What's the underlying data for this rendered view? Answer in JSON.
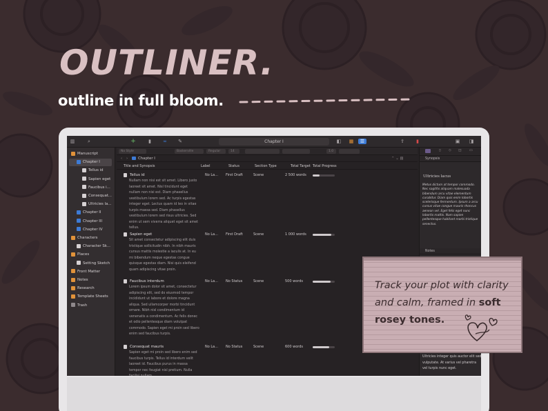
{
  "hero": {
    "title": "OUTLINER.",
    "subtitle": "outline in full bloom."
  },
  "toolbar": {
    "document_title": "Chapter I"
  },
  "format_bar": {
    "style": "No Style",
    "font": "Baskerville",
    "weight": "Regular",
    "size": "14",
    "line_spacing": "1.0"
  },
  "binder": {
    "items": [
      {
        "label": "Manuscript",
        "indent": 0,
        "icon": "folder-icon"
      },
      {
        "label": "Chapter I",
        "indent": 1,
        "icon": "folder-icon",
        "selected": true
      },
      {
        "label": "Tellus id",
        "indent": 2,
        "icon": "document-icon"
      },
      {
        "label": "Sapien eget",
        "indent": 2,
        "icon": "document-icon"
      },
      {
        "label": "Faucibus i...",
        "indent": 2,
        "icon": "document-icon"
      },
      {
        "label": "Consequat...",
        "indent": 2,
        "icon": "document-icon"
      },
      {
        "label": "Ultricies la...",
        "indent": 2,
        "icon": "document-icon"
      },
      {
        "label": "Chapter II",
        "indent": 1,
        "icon": "folder-icon"
      },
      {
        "label": "Chapter III",
        "indent": 1,
        "icon": "folder-icon"
      },
      {
        "label": "Chapter IV",
        "indent": 1,
        "icon": "folder-icon"
      },
      {
        "label": "Characters",
        "indent": 0,
        "icon": "folder-icon"
      },
      {
        "label": "Character Sk...",
        "indent": 1,
        "icon": "document-icon"
      },
      {
        "label": "Places",
        "indent": 0,
        "icon": "folder-icon"
      },
      {
        "label": "Setting Sketch",
        "indent": 1,
        "icon": "document-icon"
      },
      {
        "label": "Front Matter",
        "indent": 0,
        "icon": "folder-icon"
      },
      {
        "label": "Notes",
        "indent": 0,
        "icon": "folder-icon"
      },
      {
        "label": "Research",
        "indent": 0,
        "icon": "folder-icon"
      },
      {
        "label": "Template Sheets",
        "indent": 0,
        "icon": "folder-icon"
      },
      {
        "label": "Trash",
        "indent": 0,
        "icon": "trash-icon"
      }
    ]
  },
  "outline": {
    "path": "Chapter I",
    "columns": {
      "title": "Title and Synopsis",
      "label": "Label",
      "status": "Status",
      "section": "Section Type",
      "target": "Total Target",
      "progress": "Total Progress"
    },
    "rows": [
      {
        "title": "Tellus id",
        "synopsis": "Nullam non nisi est sit amet. Libero justo laoreet sit amet. Nisl tincidunt eget nullam non nisi est. Diam phasellus vestibulum lorem sed. Ac turpis egestas integer eget. Lectus quam id leo in vitae turpis massa sed. Diam phasellus vestibulum lorem sed risus ultricies. Sed enim ut sem viverra aliquet eget sit amet tellus.",
        "label": "No La...",
        "status": "First Draft",
        "section": "Scene",
        "target": "2 500 words",
        "progress": 0.3
      },
      {
        "title": "Sapien eget",
        "synopsis": "Sit amet consectetur adipiscing elit duis tristique sollicitudin nibh. In nibh mauris cursus mattis molestie a iaculis at. In eu mi bibendum neque egestas congue quisque egestas diam. Nisi quis eleifend quam adipiscing vitae proin.",
        "label": "No La...",
        "status": "First Draft",
        "section": "Scene",
        "target": "1 000 words",
        "progress": 0.85
      },
      {
        "title": "Faucibus interdum",
        "synopsis": "Lorem ipsum dolor sit amet, consectetur adipiscing elit, sed do eiusmod tempor incididunt ut labore et dolore magna aliqua. Sed ullamcorper morbi tincidunt ornare. Nibh nisl condimentum id venenatis a condimentum. Ac felis donec et odio pellentesque diam volutpat commodo. Sapien eget mi proin sed libero enim sed faucibus turpis.",
        "label": "No La...",
        "status": "No Status",
        "section": "Scene",
        "target": "500 words",
        "progress": 0.8
      },
      {
        "title": "Consequat mauris",
        "synopsis": "Sapien eget mi proin sed libero enim sed faucibus turpis. Tellus id interdum velit laoreet id. Faucibus purus in massa tempor nec feugiat nisl pretium. Nulla facilisi nullam",
        "label": "No La...",
        "status": "No Status",
        "section": "Scene",
        "target": "600 words",
        "progress": 0.75
      }
    ]
  },
  "inspector": {
    "synopsis_header": "Synopsis",
    "synopsis_title": "Ultricies lacus",
    "synopsis_body": "Metus dictum at tempor commodo. Nec sagittis aliquam malesuada bibendum arcu vitae elementum curabitur. Diam quis enim lobortis scelerisque fermentum. Ipsum a arcu cursus vitae congue mauris rhoncus aenean vel. Eget felis eget nunc lobortis mattis. Nam sapien pellentesque habitant morbi tristique senectus.",
    "notes_header": "Notes",
    "notes_body": "Ultricies integer quis auctor elit sed vulputate. At varius vel pharetra vel turpis nunc eget."
  },
  "card": {
    "text_1": "Track your plot with clarity and calm, framed in ",
    "bold_1": "soft rosey tones",
    "text_2": "."
  },
  "colors": {
    "background": "#3b2c2e",
    "hero_title": "#d9c0c2",
    "card": "#c9aeb3",
    "card_border": "#8c7478",
    "accent": "#3d7bd6"
  }
}
